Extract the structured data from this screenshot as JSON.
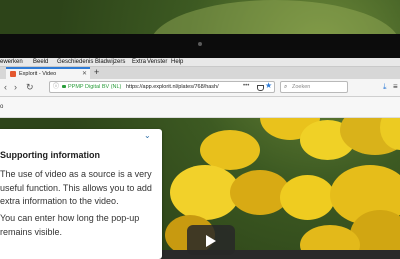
{
  "menubar": {
    "items": [
      "Bewerken",
      "Beeld",
      "Geschiedenis",
      "Bladwijzers",
      "Extra",
      "Venster",
      "Help"
    ]
  },
  "tab": {
    "title": "Explorit - Video"
  },
  "urlbar": {
    "org": "PPMP Digital BV (NL)",
    "url": "https://app.explorit.nl/plates/768/hash/"
  },
  "search": {
    "placeholder": "Zoeken"
  },
  "subbar": {
    "text": "o"
  },
  "card": {
    "title": "Supporting information",
    "paragraph1": "The use of video as a source is a very useful function. This allows you to add extra information to the video.",
    "paragraph2": "You can enter how long the pop-up remains visible."
  },
  "colors": {
    "accent": "#2e7bd6",
    "secure": "#2a9d3a",
    "card_link": "#2d6ea8"
  },
  "icons": [
    "info-icon",
    "lock-icon",
    "more-icon",
    "pocket-icon",
    "bookmark-star-icon",
    "search-icon",
    "download-icon",
    "menu-icon",
    "chevron-down-icon",
    "play-icon"
  ]
}
